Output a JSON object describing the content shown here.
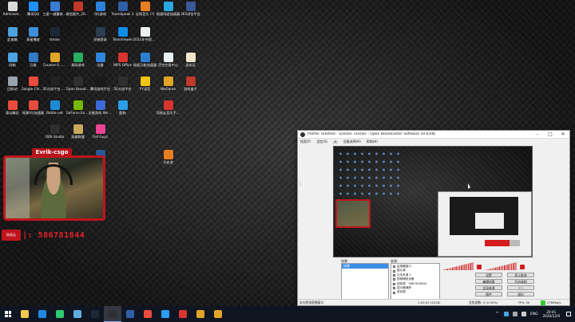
{
  "desktop": {
    "icons": [
      {
        "label": "Administr...",
        "color": "#d9d9d9"
      },
      {
        "label": "腾讯QQ",
        "color": "#1e90ff"
      },
      {
        "label": "三星一键重装系统",
        "color": "#3a7bd5"
      },
      {
        "label": "微信图片_2020092...",
        "color": "#c0392b"
      },
      {
        "label": "QQ游戏",
        "color": "#2b82d9"
      },
      {
        "label": "TeamSpeak 3",
        "color": "#2f5fa6"
      },
      {
        "label": "全网音乐 (?)",
        "color": "#e67e22"
      },
      {
        "label": "極速网游加速器",
        "color": "#2aa7e0"
      },
      {
        "label": "365浏览平台",
        "color": "#3b5998"
      },
      {
        "label": "此电脑",
        "color": "#4aa3df"
      },
      {
        "label": "高速播放",
        "color": "#3f8fd8"
      },
      {
        "label": "steam",
        "color": "#1b2838"
      },
      {
        "label": "",
        "color": "#000000"
      },
      {
        "label": "亚服登录",
        "color": "#2c3e50"
      },
      {
        "label": "TeamViewer",
        "color": "#0e8ee9"
      },
      {
        "label": "2021年中国网络安全...",
        "color": "#ecf0f1"
      },
      {
        "label": "",
        "color": "#000000"
      },
      {
        "label": "",
        "color": "#000000"
      },
      {
        "label": "网络",
        "color": "#4aa3df"
      },
      {
        "label": "万能",
        "color": "#3478c6"
      },
      {
        "label": "Counter-S... Global Off...",
        "color": "#e0a526"
      },
      {
        "label": "易网游戏",
        "color": "#27ae60"
      },
      {
        "label": "迅雷",
        "color": "#2e86de"
      },
      {
        "label": "WPS Office",
        "color": "#d9352f"
      },
      {
        "label": "极速万能加速器",
        "color": "#2d7fd1"
      },
      {
        "label": "浮空交易中心",
        "color": "#e8f0f8"
      },
      {
        "label": "身份证",
        "color": "#f0e6c8"
      },
      {
        "label": "回收站",
        "color": "#9aa4ad"
      },
      {
        "label": "Google Chrome",
        "color": "#e74c3c"
      },
      {
        "label": "5E对战平台 2.0",
        "color": "#222222"
      },
      {
        "label": "Open Broadcast...",
        "color": "#302e31"
      },
      {
        "label": "腾讯游戏平台",
        "color": "#1a1a1a"
      },
      {
        "label": "5E对战平台",
        "color": "#2f2f2f"
      },
      {
        "label": "YY语音",
        "color": "#f1c40f"
      },
      {
        "label": "WeGame",
        "color": "#e0a526"
      },
      {
        "label": "游戏盒子",
        "color": "#c0392b"
      },
      {
        "label": "驱动精灵",
        "color": "#e74c3c"
      },
      {
        "label": "网易UU加速器",
        "color": "#e74c3c"
      },
      {
        "label": "Battle.net",
        "color": "#1c8cd6"
      },
      {
        "label": "GeForce Experience",
        "color": "#76b900"
      },
      {
        "label": "全能游戏 WeGame版",
        "color": "#3c6ad6"
      },
      {
        "label": "酷狗",
        "color": "#2b9de9"
      },
      {
        "label": "",
        "color": "#000000"
      },
      {
        "label": "网易云音乐手机平台",
        "color": "#d9352f"
      },
      {
        "label": "",
        "color": "#000000"
      },
      {
        "label": "",
        "color": "#000000"
      },
      {
        "label": "",
        "color": "#000000"
      },
      {
        "label": "OBS Studio",
        "color": "#302e31"
      },
      {
        "label": "英雄联盟",
        "color": "#c8a85a"
      },
      {
        "label": "Fall Guys",
        "color": "#e84393"
      },
      {
        "label": "",
        "color": "#000000"
      },
      {
        "label": "",
        "color": "#000000"
      },
      {
        "label": "",
        "color": "#000000"
      },
      {
        "label": "",
        "color": "#000000"
      },
      {
        "label": "",
        "color": "#000000"
      },
      {
        "label": "",
        "color": "#000000"
      },
      {
        "label": "",
        "color": "#000000"
      },
      {
        "label": "",
        "color": "#000000"
      },
      {
        "label": "文文档",
        "color": "#2b5797"
      },
      {
        "label": "",
        "color": "#000000"
      },
      {
        "label": "",
        "color": "#000000"
      },
      {
        "label": "开启游",
        "color": "#e67e22"
      },
      {
        "label": "",
        "color": "#000000"
      }
    ]
  },
  "webcam": {
    "title": "Evrik-csgo",
    "badge": "网易云",
    "number": "|: 586781844"
  },
  "obs": {
    "title": "Profile: Untitled - Scenes: scenes - Open Broadcaster Software v0.659b",
    "menu": [
      "档案(F)",
      "设定(S)",
      "(P)",
      "设备选择(H)",
      "帮助(H)"
    ],
    "scenes_label": "场景:",
    "scenes": [
      "场景"
    ],
    "sources_label": "来源:",
    "sources": [
      "监视器窗口",
      "图片源",
      "文本来源 2",
      "视频捕获设备",
      "回放源 - 5867818844",
      "显示器捕获",
      "音效源"
    ],
    "buttons": {
      "settings": "设置",
      "stop_stream": "停止推流",
      "edit_scene": "编辑场景",
      "start_recording": "开启录制",
      "global_sources": "全局来源",
      "preview": "预览",
      "plugins": "插件",
      "exit": "退出"
    },
    "status": {
      "left": "实光检测直播窗口",
      "time": "1:00:02 (2218)",
      "dropped": "丢失帧数: 0 (0.00%)",
      "fps": "FPS: 30",
      "kbps": "2786kb/s"
    },
    "colors": {
      "meter": "#d11e1e",
      "selected_scene": "#3d8ee6",
      "kbps_ok": "#2ccf2c"
    }
  },
  "taskbar": {
    "apps": [
      {
        "name": "file-explorer",
        "color": "#f2c94c"
      },
      {
        "name": "ie-browser",
        "color": "#1e88e5"
      },
      {
        "name": "qq-music",
        "color": "#2ecc71"
      },
      {
        "name": "network",
        "color": "#5dade2"
      },
      {
        "name": "steam",
        "color": "#1b2838"
      },
      {
        "name": "obs",
        "color": "#302e31"
      },
      {
        "name": "teamspeak",
        "color": "#2f5fa6"
      },
      {
        "name": "chrome",
        "color": "#e74c3c"
      },
      {
        "name": "qq",
        "color": "#2a9df4"
      },
      {
        "name": "netease",
        "color": "#d9352f"
      },
      {
        "name": "wegame",
        "color": "#e0a526"
      },
      {
        "name": "csgo",
        "color": "#e0a526"
      }
    ],
    "tray": {
      "chevron": "^",
      "lang": "ENG",
      "time": "20:41",
      "date": "2020/12/9"
    }
  }
}
